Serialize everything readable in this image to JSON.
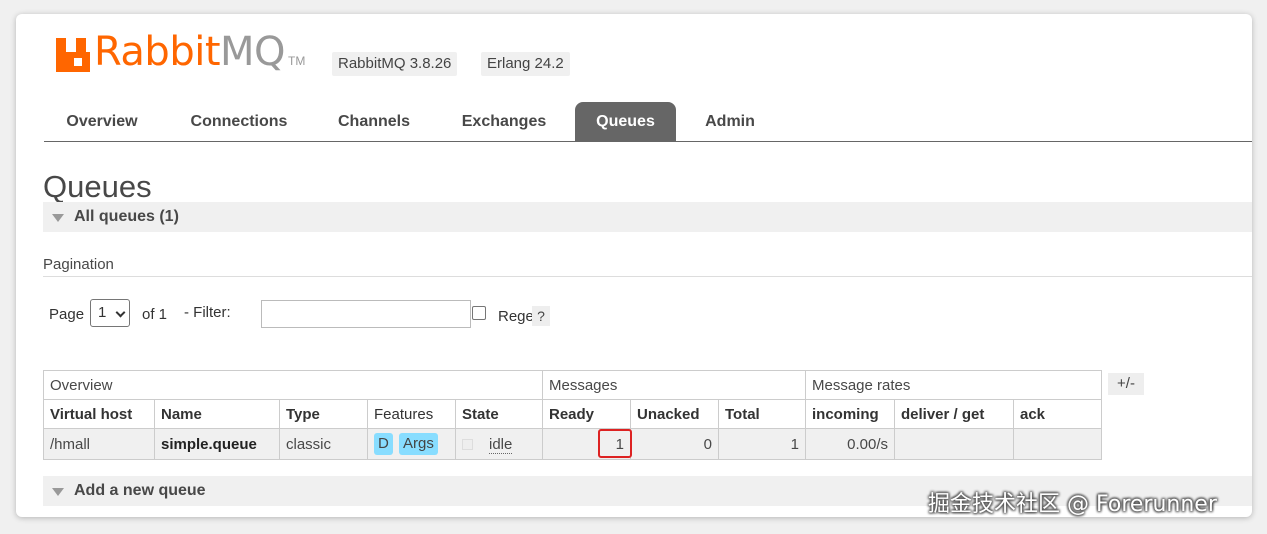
{
  "header": {
    "logo_rabbit": "Rabbit",
    "logo_mq": "MQ",
    "logo_tm": "TM",
    "rabbitmq_version": "RabbitMQ 3.8.26",
    "erlang_version": "Erlang 24.2"
  },
  "tabs": [
    {
      "label": "Overview"
    },
    {
      "label": "Connections"
    },
    {
      "label": "Channels"
    },
    {
      "label": "Exchanges"
    },
    {
      "label": "Queues",
      "active": true
    },
    {
      "label": "Admin"
    }
  ],
  "page_title": "Queues",
  "all_queues_label": "All queues (1)",
  "pagination": {
    "title": "Pagination",
    "page_label": "Page",
    "page_value": "1",
    "of_label": "of 1",
    "filter_label": "- Filter:",
    "filter_value": "",
    "regex_label": "Regex",
    "help_label": "?"
  },
  "table": {
    "groups": [
      "Overview",
      "Messages",
      "Message rates"
    ],
    "columns": [
      "Virtual host",
      "Name",
      "Type",
      "Features",
      "State",
      "Ready",
      "Unacked",
      "Total",
      "incoming",
      "deliver / get",
      "ack"
    ],
    "toggle_label": "+/-",
    "rows": [
      {
        "vhost": "/hmall",
        "name": "simple.queue",
        "type": "classic",
        "features": [
          "D",
          "Args"
        ],
        "state": "idle",
        "ready": "1",
        "unacked": "0",
        "total": "1",
        "incoming": "0.00/s",
        "deliver_get": "",
        "ack": ""
      }
    ]
  },
  "add_queue_label": "Add a new queue",
  "watermark": "掘金技术社区 @ Forerunner",
  "colors": {
    "brand_orange": "#ff6600",
    "active_tab": "#666666",
    "feature_tag": "#88ddff",
    "highlight_box": "#dd2222"
  }
}
